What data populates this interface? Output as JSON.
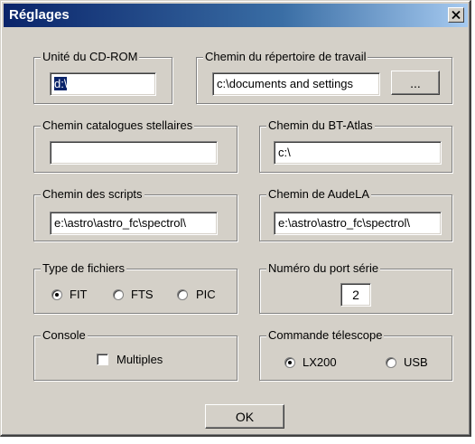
{
  "window": {
    "title": "Réglages",
    "close_icon": "close-icon"
  },
  "cdrom": {
    "label": "Unité du CD-ROM",
    "value": "d:\\"
  },
  "workdir": {
    "label": "Chemin du répertoire de travail",
    "value": "c:\\documents and settings",
    "browse_label": "..."
  },
  "catalogs": {
    "label": "Chemin catalogues stellaires",
    "value": ""
  },
  "btatlas": {
    "label": "Chemin du BT-Atlas",
    "value": "c:\\"
  },
  "scripts": {
    "label": "Chemin des scripts",
    "value": "e:\\astro\\astro_fc\\spectrol\\"
  },
  "audela": {
    "label": "Chemin de AudeLA",
    "value": "e:\\astro\\astro_fc\\spectrol\\"
  },
  "filetype": {
    "label": "Type de fichiers",
    "options": [
      "FIT",
      "FTS",
      "PIC"
    ],
    "selected": "FIT"
  },
  "serialport": {
    "label": "Numéro du port série",
    "value": "2"
  },
  "console": {
    "label": "Console",
    "checkbox_label": "Multiples",
    "checked": false
  },
  "telescope": {
    "label": "Commande télescope",
    "options": [
      "LX200",
      "USB"
    ],
    "selected": "LX200"
  },
  "ok_label": "OK"
}
